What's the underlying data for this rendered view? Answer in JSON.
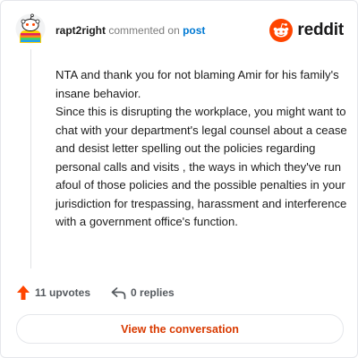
{
  "comment": {
    "username": "rapt2right",
    "action_text": "commented on",
    "post_label": "post",
    "body_lines": [
      "NTA and thank you for not blaming Amir for his family's insane behavior.",
      "Since this is disrupting the workplace, you might want to chat with your department's legal counsel about a cease and desist letter spelling out the policies regarding personal calls and visits , the ways in which they've run afoul of those policies and the possible penalties in your jurisdiction for trespassing, harassment and interference with a government office's function."
    ]
  },
  "brand": {
    "name": "reddit",
    "icon": "reddit-logo-icon",
    "color": "#ff4500"
  },
  "stats": {
    "upvotes_label": "11 upvotes",
    "upvote_icon": "upvote-arrow-icon",
    "replies_label": "0 replies",
    "reply_icon": "reply-arrow-icon"
  },
  "cta": {
    "label": "View the conversation"
  },
  "colors": {
    "accent": "#d93a00",
    "link": "#0079d3",
    "upvote": "#ff4500"
  }
}
